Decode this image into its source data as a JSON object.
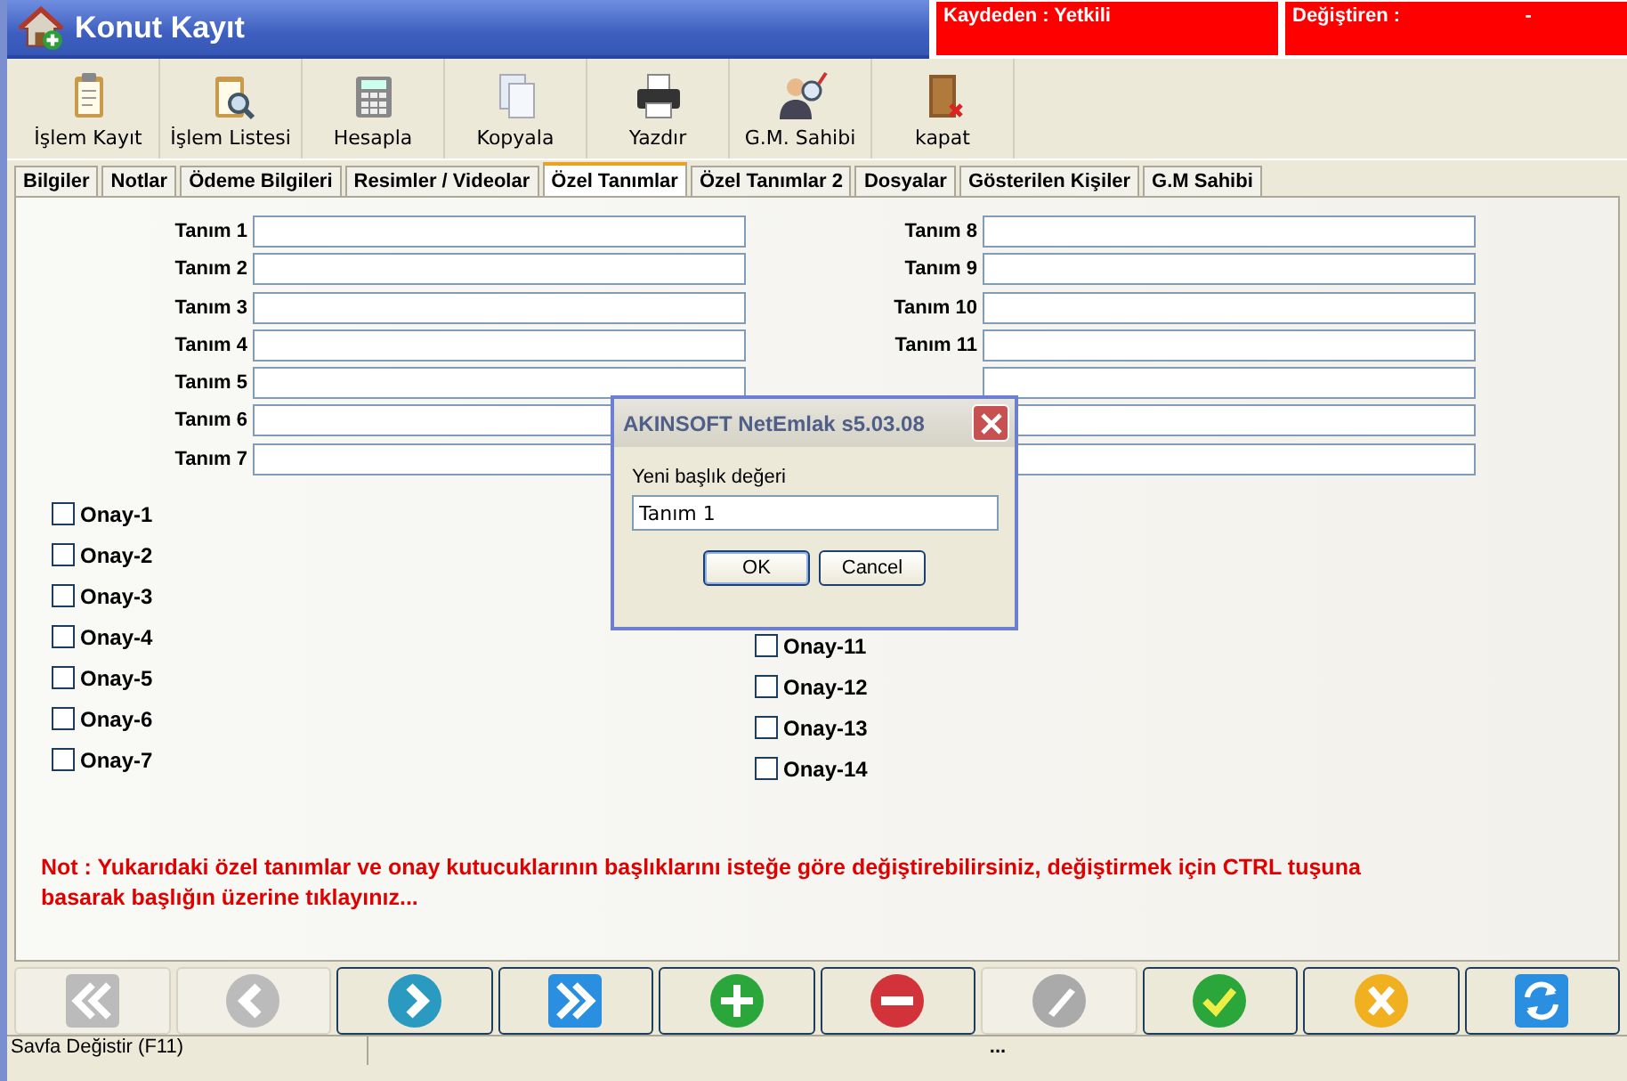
{
  "window": {
    "title": "Konut Kayıt"
  },
  "info_boxes": [
    {
      "text": "Kaydeden : Yetkili"
    },
    {
      "text": "Değiştiren :                       -"
    }
  ],
  "toolbar": [
    {
      "label": "İşlem Kayıt",
      "kind": "clipboard"
    },
    {
      "label": "İşlem Listesi",
      "kind": "search-list"
    },
    {
      "label": "Hesapla",
      "kind": "calculator"
    },
    {
      "label": "Kopyala",
      "kind": "copy"
    },
    {
      "label": "Yazdır",
      "kind": "printer"
    },
    {
      "label": "G.M. Sahibi",
      "kind": "person"
    },
    {
      "label": "kapat",
      "kind": "door"
    }
  ],
  "tabs": [
    {
      "label": "Bilgiler",
      "selected": false
    },
    {
      "label": "Notlar",
      "selected": false
    },
    {
      "label": "Ödeme Bilgileri",
      "selected": false
    },
    {
      "label": "Resimler / Videolar",
      "selected": false
    },
    {
      "label": "Özel Tanımlar",
      "selected": true
    },
    {
      "label": "Özel Tanımlar 2",
      "selected": false
    },
    {
      "label": "Dosyalar",
      "selected": false
    },
    {
      "label": "Gösterilen Kişiler",
      "selected": false
    },
    {
      "label": "G.M Sahibi",
      "selected": false
    }
  ],
  "fields_left": [
    {
      "label": "Tanım 1"
    },
    {
      "label": "Tanım 2"
    },
    {
      "label": "Tanım 3"
    },
    {
      "label": "Tanım 4"
    },
    {
      "label": "Tanım 5"
    },
    {
      "label": "Tanım 6"
    },
    {
      "label": "Tanım 7"
    }
  ],
  "fields_right": [
    {
      "kind": "labeled",
      "label": "Tanım 8"
    },
    {
      "kind": "labeled",
      "label": "Tanım 9"
    },
    {
      "kind": "labeled",
      "label": "Tanım 10"
    },
    {
      "kind": "labeled",
      "label": "Tanım 11"
    },
    {
      "kind": "bare"
    },
    {
      "kind": "bare"
    },
    {
      "kind": "bare"
    }
  ],
  "checks_left": [
    {
      "label": "Onay-1",
      "checked": false
    },
    {
      "label": "Onay-2",
      "checked": false
    },
    {
      "label": "Onay-3",
      "checked": false
    },
    {
      "label": "Onay-4",
      "checked": false
    },
    {
      "label": "Onay-5",
      "checked": false
    },
    {
      "label": "Onay-6",
      "checked": false
    },
    {
      "label": "Onay-7",
      "checked": false
    }
  ],
  "checks_right": [
    {
      "label": "Onay-11",
      "checked": false
    },
    {
      "label": "Onay-12",
      "checked": false
    },
    {
      "label": "Onay-13",
      "checked": false
    },
    {
      "label": "Onay-14",
      "checked": false
    }
  ],
  "note": "Not :  Yukarıdaki özel tanımlar ve onay kutucuklarının başlıklarını isteğe göre değiştirebilirsiniz, değiştirmek için CTRL tuşuna basarak başlığın üzerine tıklayınız...",
  "nav_buttons": [
    {
      "kind": "first",
      "disabled": true
    },
    {
      "kind": "prev",
      "disabled": true
    },
    {
      "kind": "next",
      "disabled": false
    },
    {
      "kind": "last",
      "disabled": false
    },
    {
      "kind": "add",
      "disabled": false
    },
    {
      "kind": "delete",
      "disabled": false
    },
    {
      "kind": "edit",
      "disabled": true
    },
    {
      "kind": "save",
      "disabled": false
    },
    {
      "kind": "cancel",
      "disabled": false
    },
    {
      "kind": "refresh",
      "disabled": false
    }
  ],
  "status_bar": {
    "left": "Savfa Değistir (F11)",
    "center": "..."
  },
  "dialog": {
    "title": "AKINSOFT NetEmlak s5.03.08",
    "prompt": "Yeni başlık değeri",
    "value": "Tanım 1",
    "buttons": [
      "OK",
      "Cancel"
    ]
  }
}
